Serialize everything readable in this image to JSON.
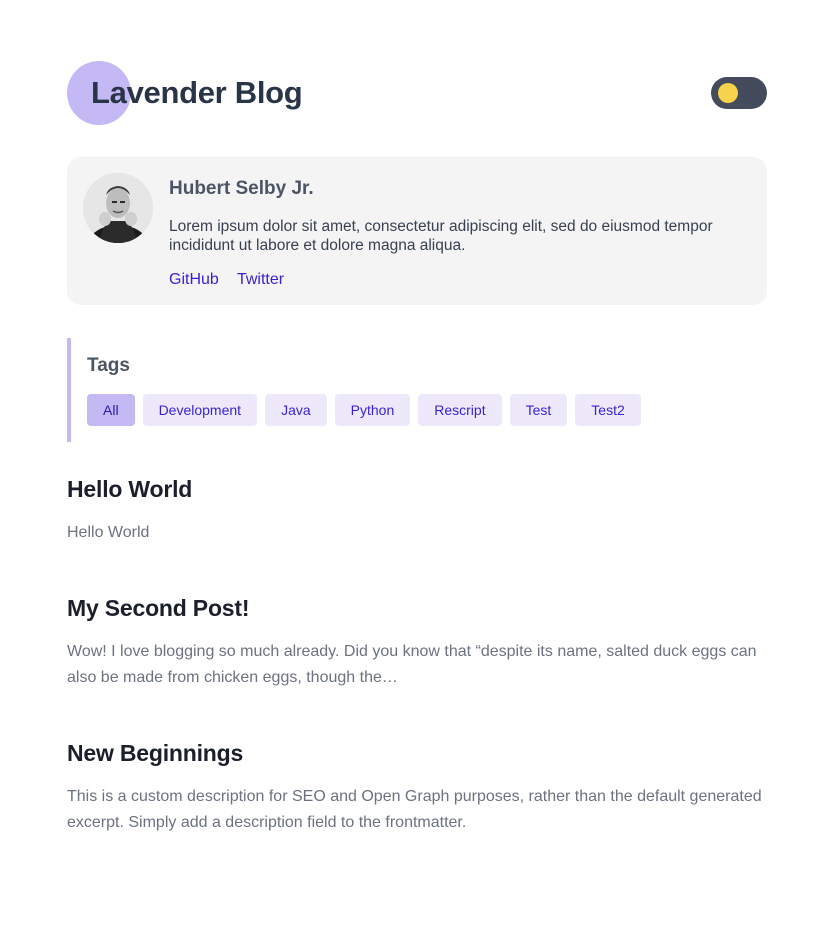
{
  "header": {
    "title": "Lavender Blog",
    "theme_toggle": {
      "state": "light",
      "knob_color": "#f8d24a"
    }
  },
  "author": {
    "name": "Hubert Selby Jr.",
    "bio": "Lorem ipsum dolor sit amet, consectetur adipiscing elit, sed do eiusmod tempor incididunt ut labore et dolore magna aliqua.",
    "links": [
      {
        "label": "GitHub"
      },
      {
        "label": "Twitter"
      }
    ]
  },
  "tags": {
    "title": "Tags",
    "items": [
      {
        "label": "All",
        "active": true
      },
      {
        "label": "Development",
        "active": false
      },
      {
        "label": "Java",
        "active": false
      },
      {
        "label": "Python",
        "active": false
      },
      {
        "label": "Rescript",
        "active": false
      },
      {
        "label": "Test",
        "active": false
      },
      {
        "label": "Test2",
        "active": false
      }
    ]
  },
  "posts": [
    {
      "title": "Hello World",
      "excerpt": "Hello World"
    },
    {
      "title": "My Second Post!",
      "excerpt": "Wow! I love blogging so much already. Did you know that “despite its name, salted duck eggs can also be made from chicken eggs, though the…"
    },
    {
      "title": "New Beginnings",
      "excerpt": "This is a custom description for SEO and Open Graph purposes, rather than the default generated excerpt. Simply add a description field to the frontmatter."
    }
  ],
  "colors": {
    "accent": "#c4b8f5",
    "link": "#3b1fd6",
    "tag_bg": "#ede9fb"
  }
}
